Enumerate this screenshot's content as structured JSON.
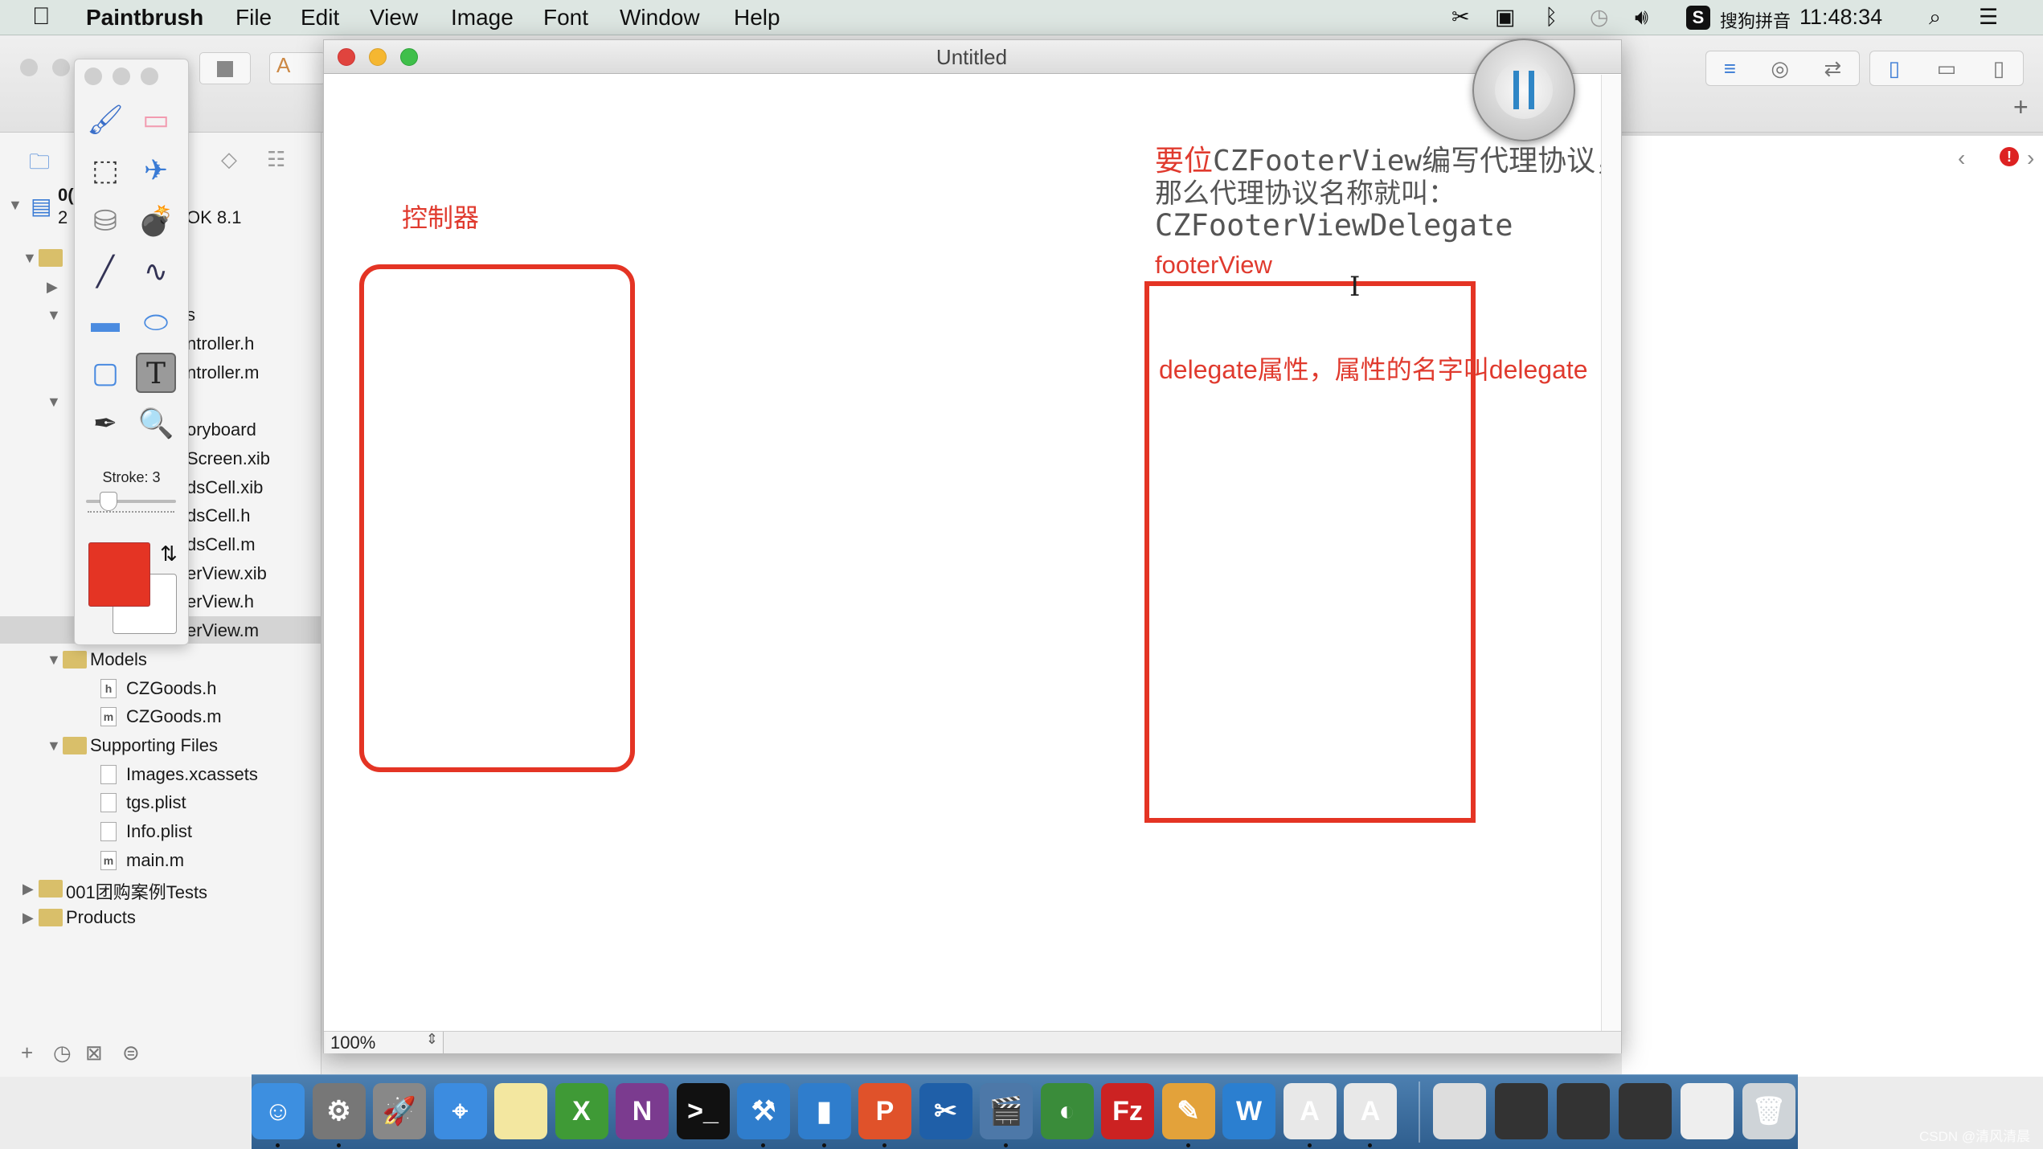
{
  "menubar": {
    "app": "Paintbrush",
    "items": [
      "File",
      "Edit",
      "View",
      "Image",
      "Font",
      "Window",
      "Help"
    ],
    "ime": "搜狗拼音",
    "time": "11:48:34"
  },
  "xcode": {
    "sdk_text": "OK 8.1",
    "project_line1": "0(",
    "project_line2": "2",
    "files": [
      {
        "label": "",
        "indent": 1,
        "type": "folder",
        "tri": "down"
      },
      {
        "label": "",
        "indent": 2,
        "type": "none",
        "tri": "right"
      },
      {
        "label": "s",
        "indent": 2,
        "type": "partial",
        "tri": "down"
      },
      {
        "label": "ntroller.h",
        "indent": 3,
        "type": "partial"
      },
      {
        "label": "ntroller.m",
        "indent": 3,
        "type": "partial"
      },
      {
        "label": "",
        "indent": 2,
        "type": "none",
        "tri": "down"
      },
      {
        "label": "oryboard",
        "indent": 3,
        "type": "partial"
      },
      {
        "label": "Screen.xib",
        "indent": 3,
        "type": "partial"
      },
      {
        "label": "dsCell.xib",
        "indent": 3,
        "type": "partial"
      },
      {
        "label": "dsCell.h",
        "indent": 3,
        "type": "partial"
      },
      {
        "label": "dsCell.m",
        "indent": 3,
        "type": "partial"
      },
      {
        "label": "erView.xib",
        "indent": 3,
        "type": "partial"
      },
      {
        "label": "erView.h",
        "indent": 3,
        "type": "partial"
      },
      {
        "label": "erView.m",
        "indent": 3,
        "type": "partial",
        "selected": true
      },
      {
        "label": "Models",
        "indent": 2,
        "type": "folder",
        "tri": "down"
      },
      {
        "label": "CZGoods.h",
        "indent": 3,
        "type": "file",
        "glyph": "h"
      },
      {
        "label": "CZGoods.m",
        "indent": 3,
        "type": "file",
        "glyph": "m"
      },
      {
        "label": "Supporting Files",
        "indent": 2,
        "type": "folder",
        "tri": "down"
      },
      {
        "label": "Images.xcassets",
        "indent": 3,
        "type": "file",
        "glyph": ""
      },
      {
        "label": "tgs.plist",
        "indent": 3,
        "type": "file",
        "glyph": ""
      },
      {
        "label": "Info.plist",
        "indent": 3,
        "type": "file",
        "glyph": ""
      },
      {
        "label": "main.m",
        "indent": 3,
        "type": "file",
        "glyph": "m"
      },
      {
        "label": "001团购案例Tests",
        "indent": 1,
        "type": "folder",
        "tri": "right"
      },
      {
        "label": "Products",
        "indent": 1,
        "type": "folder",
        "tri": "right"
      }
    ]
  },
  "paintbrush": {
    "title": "Untitled",
    "zoom": "100%",
    "stroke_label": "Stroke: 3",
    "stroke_value": 3,
    "primary_color": "#e43424",
    "secondary_color": "#ffffff",
    "tools": [
      "brush",
      "eraser",
      "marquee-select",
      "spray",
      "paint-bucket",
      "bomb",
      "line",
      "curve",
      "rectangle",
      "ellipse",
      "rounded-rectangle",
      "text",
      "eyedropper",
      "magnifier"
    ],
    "selected_tool": "text"
  },
  "canvas": {
    "label_controller": "控制器",
    "note_line1_red": "要位",
    "note_line1_rest": "CZFooterView编写代理协议，",
    "note_line2": "那么代理协议名称就叫：",
    "note_line3": "CZFooterViewDelegate",
    "note_footer": "footerView",
    "delegate_text": "delegate属性，属性的名字叫delegate",
    "stroke_color": "#e43424"
  },
  "dock": {
    "apps": [
      {
        "name": "finder",
        "color": "#3d8fe0",
        "glyph": "☺",
        "dot": true
      },
      {
        "name": "system-preferences",
        "color": "#777",
        "glyph": "⚙",
        "dot": true
      },
      {
        "name": "launchpad",
        "color": "#888",
        "glyph": "🚀"
      },
      {
        "name": "safari",
        "color": "#3c8ce0",
        "glyph": "⌖"
      },
      {
        "name": "notes",
        "color": "#f3e7a0",
        "glyph": ""
      },
      {
        "name": "excel-x",
        "color": "#3f9a36",
        "glyph": "X"
      },
      {
        "name": "onenote",
        "color": "#7b3b8f",
        "glyph": "N"
      },
      {
        "name": "terminal",
        "color": "#111",
        "glyph": ">_"
      },
      {
        "name": "xcode",
        "color": "#2f7dcc",
        "glyph": "⚒",
        "dot": true
      },
      {
        "name": "simulator",
        "color": "#2f7dcc",
        "glyph": "▮",
        "dot": true
      },
      {
        "name": "powerpoint-p",
        "color": "#e0522a",
        "glyph": "P",
        "dot": true
      },
      {
        "name": "snipping",
        "color": "#1f5fa8",
        "glyph": "✂"
      },
      {
        "name": "video",
        "color": "#4d78a8",
        "glyph": "🎬",
        "dot": true
      },
      {
        "name": "pro-app",
        "color": "#3a8c3a",
        "glyph": "◐"
      },
      {
        "name": "filezilla",
        "color": "#c22",
        "glyph": "Fz"
      },
      {
        "name": "sketch-app",
        "color": "#e3a23a",
        "glyph": "✎",
        "dot": true
      },
      {
        "name": "word-w",
        "color": "#2b7fd0",
        "glyph": "W"
      },
      {
        "name": "app-a1",
        "color": "#e8e8e8",
        "glyph": "A",
        "dot": true
      },
      {
        "name": "app-a2",
        "color": "#e8e8e8",
        "glyph": "A",
        "dot": true
      },
      {
        "name": "doc-1",
        "color": "#ddd",
        "glyph": ""
      },
      {
        "name": "screen-1",
        "color": "#333",
        "glyph": ""
      },
      {
        "name": "screen-2",
        "color": "#333",
        "glyph": ""
      },
      {
        "name": "screen-3",
        "color": "#333",
        "glyph": ""
      },
      {
        "name": "doc-2",
        "color": "#eee",
        "glyph": ""
      },
      {
        "name": "trash",
        "color": "#cfd4d8",
        "glyph": "🗑"
      }
    ]
  },
  "watermark": "CSDN @清风清晨"
}
